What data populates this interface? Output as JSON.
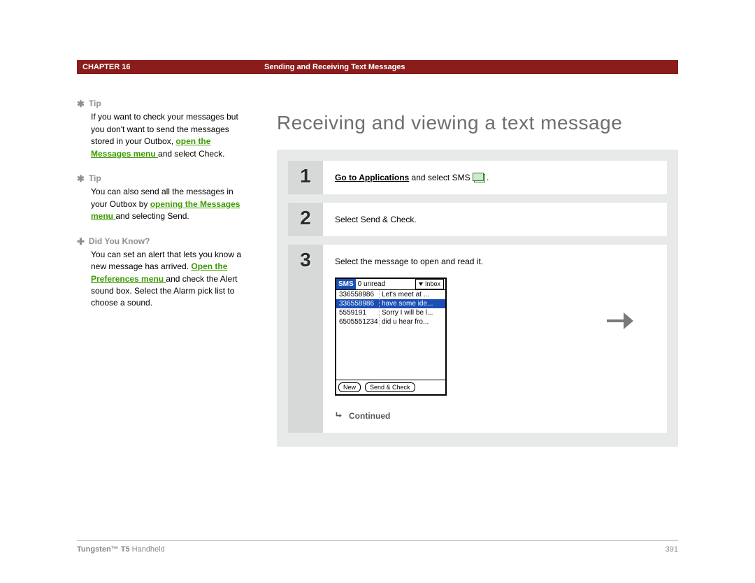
{
  "header": {
    "chapter_label": "CHAPTER 16",
    "section_title": "Sending and Receiving Text Messages"
  },
  "page_title": "Receiving and viewing a text message",
  "sidebar": {
    "items": [
      {
        "heading": "Tip",
        "kind": "tip",
        "pre": "If you want to check your messages but you don't want to send the messages stored in your Outbox, ",
        "link": "open the Messages menu ",
        "post": "and select Check."
      },
      {
        "heading": "Tip",
        "kind": "tip",
        "pre": "You can also send all the messages in your Outbox by ",
        "link": "opening the Messages menu ",
        "post": "and selecting Send."
      },
      {
        "heading": "Did You Know?",
        "kind": "dyk",
        "pre": "You can set an alert that lets you know a new message has arrived. ",
        "link": "Open the Preferences menu ",
        "post": "and check the Alert sound box. Select the Alarm pick list to choose a sound."
      }
    ]
  },
  "steps": [
    {
      "num": "1",
      "link": "Go to Applications",
      "rest": " and select SMS ",
      "tail": "."
    },
    {
      "num": "2",
      "plain": "Select Send & Check."
    },
    {
      "num": "3",
      "plain": "Select the message to open and read it."
    }
  ],
  "device": {
    "sms_badge": "SMS",
    "unread": "0 unread",
    "inbox": "Inbox",
    "rows": [
      {
        "a": "336558986",
        "b": "Let's meet at ..."
      },
      {
        "a": "336558986",
        "b": "have some ide..."
      },
      {
        "a": "5559191",
        "b": "Sorry I will be l..."
      },
      {
        "a": "6505551234",
        "b": "did u hear fro..."
      }
    ],
    "btn_new": "New",
    "btn_send": "Send & Check"
  },
  "continued_label": "Continued",
  "footer": {
    "product_bold": "Tungsten™ T5",
    "product_rest": " Handheld",
    "page_no": "391"
  }
}
